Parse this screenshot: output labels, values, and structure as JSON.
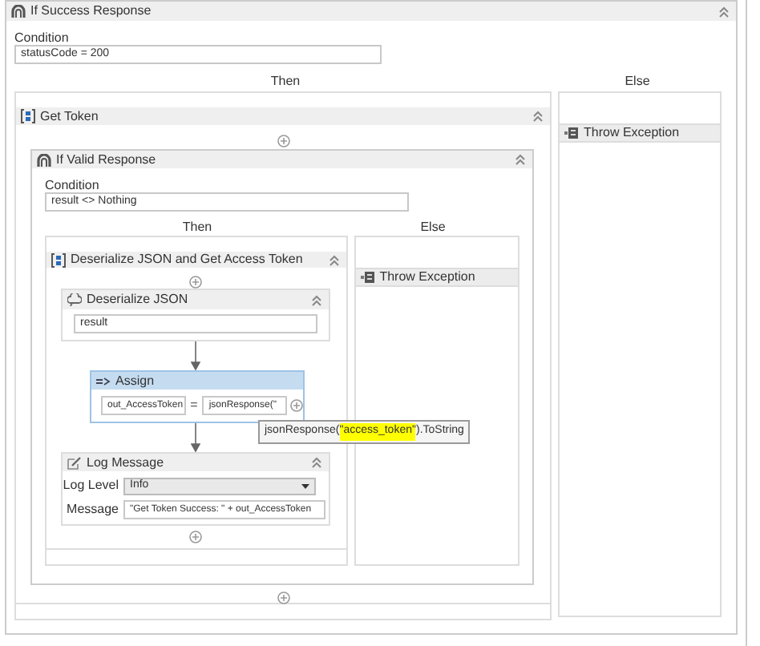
{
  "if_success": {
    "title": "If Success Response",
    "condition_label": "Condition",
    "condition": "statusCode = 200",
    "then_label": "Then",
    "else_label": "Else",
    "get_token": {
      "title": "Get Token",
      "if_valid": {
        "title": "If Valid Response",
        "condition_label": "Condition",
        "condition": "result <> Nothing",
        "then_label": "Then",
        "else_label": "Else",
        "sequence": {
          "title": "Deserialize JSON and Get Access Token",
          "deserialize": {
            "title": "Deserialize JSON",
            "input": "result"
          },
          "assign": {
            "title": "Assign",
            "selected": true,
            "to": "out_AccessToken",
            "equals": "=",
            "value": "jsonResponse(\""
          },
          "tooltip": [
            {
              "text": "jsonResponse(",
              "highlighted": false
            },
            {
              "text": "\"access_token\"",
              "highlighted": true
            },
            {
              "text": ").ToString",
              "highlighted": false
            }
          ],
          "log": {
            "title": "Log Message",
            "level_label": "Log Level",
            "level": "Info",
            "message_label": "Message",
            "message": "\"Get Token Success: \" + out_AccessToken"
          }
        },
        "else_activity": {
          "title": "Throw Exception"
        }
      }
    },
    "else_activity": {
      "title": "Throw Exception"
    }
  }
}
